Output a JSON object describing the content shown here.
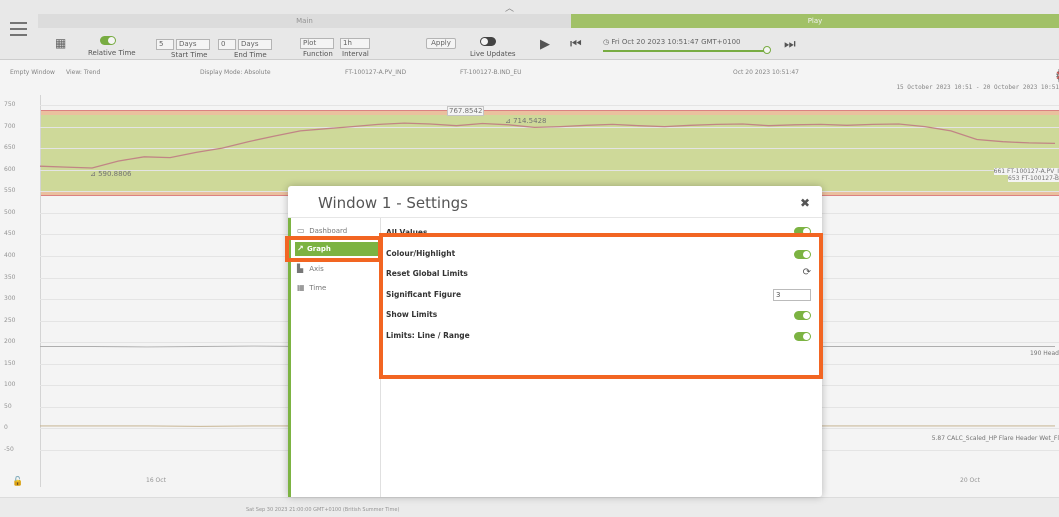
{
  "tabs": {
    "main": "Main",
    "play": "Play"
  },
  "toolbar": {
    "relative_time": "Relative Time",
    "start_value": "5",
    "start_unit": "Days",
    "start_time": "Start Time",
    "end_value": "0",
    "end_unit": "Days",
    "end_time": "End Time",
    "function_value": "Plot",
    "function_label": "Function",
    "interval_value": "1h",
    "interval_label": "Interval",
    "apply": "Apply",
    "live_updates": "Live Updates",
    "current_time": "Fri Oct 20 2023 10:51:47 GMT+0100"
  },
  "chart_header": {
    "window": "Empty Window",
    "view": "View: Trend",
    "display_mode": "Display Mode: Absolute",
    "tag1": "FT-100127-A.PV_IND",
    "tag2": "FT-100127-B.IND_EU",
    "timestamp": "Oct 20 2023 10:51:47",
    "date_range": "15 October 2023 10:51 - 20 October 2023 10:51"
  },
  "chart_data": {
    "type": "line",
    "yticks": [
      750,
      700,
      650,
      600,
      550,
      500,
      450,
      400,
      350,
      300,
      250,
      200,
      150,
      100,
      50,
      0,
      -50
    ],
    "ylim": [
      -50,
      750
    ],
    "xticks": [
      "16 Oct",
      "20 Oct"
    ],
    "annotations": [
      "767.8542",
      "714.5428",
      "590.8806"
    ],
    "right_labels": [
      "661 FT-100127-A.PV_I",
      "653 FT-100127-B",
      "190 Head",
      "5.87 CALC_Scaled_HP Flare Header Wet_Fl"
    ],
    "series": [
      {
        "name": "FT-100127-A.PV_IND",
        "values": [
          608,
          606,
          604,
          620,
          630,
          628,
          640,
          650,
          665,
          678,
          690,
          695,
          700,
          705,
          708,
          706,
          702,
          707,
          704,
          698,
          700,
          703,
          705,
          702,
          700,
          703,
          705,
          706,
          702,
          704,
          705,
          703,
          705,
          706,
          700,
          690,
          670,
          665,
          662,
          661
        ],
        "color": "#c98a8a"
      },
      {
        "name": "190 Head",
        "values": [
          190,
          190,
          189,
          190,
          191,
          190,
          190,
          189,
          190,
          190,
          190,
          190,
          190,
          190,
          190,
          190,
          190,
          190,
          190,
          190
        ],
        "color": "#b5b5b5"
      },
      {
        "name": "5.87 CALC_Scaled_HP Flare Header Wet_Fl",
        "values": [
          6,
          6,
          6,
          5,
          6,
          6,
          6,
          6,
          6,
          6,
          6,
          6,
          6,
          6,
          6,
          6,
          6,
          6,
          6,
          6
        ],
        "color": "#c9b38a"
      }
    ]
  },
  "bottom_date": "Sat Sep 30 2023 21:00:00 GMT+0100 (British Summer Time)",
  "modal": {
    "title": "Window 1 - Settings",
    "nav": [
      {
        "label": "Dashboard",
        "icon": "dashboard-icon"
      },
      {
        "label": "Graph",
        "icon": "graph-icon"
      },
      {
        "label": "Axis",
        "icon": "axis-icon"
      },
      {
        "label": "Time",
        "icon": "time-icon"
      }
    ],
    "clipped_label": "All Values",
    "settings": {
      "colour_highlight": "Colour/Highlight",
      "reset_global_limits": "Reset Global Limits",
      "significant_figure": "Significant Figure",
      "significant_figure_value": "3",
      "show_limits": "Show Limits",
      "limits_line_range": "Limits: Line / Range"
    }
  },
  "colors": {
    "accent": "#7cb342",
    "highlight": "#f26522",
    "limit_band": "#d7e39f",
    "limit_outer": "#f5c8a4"
  }
}
